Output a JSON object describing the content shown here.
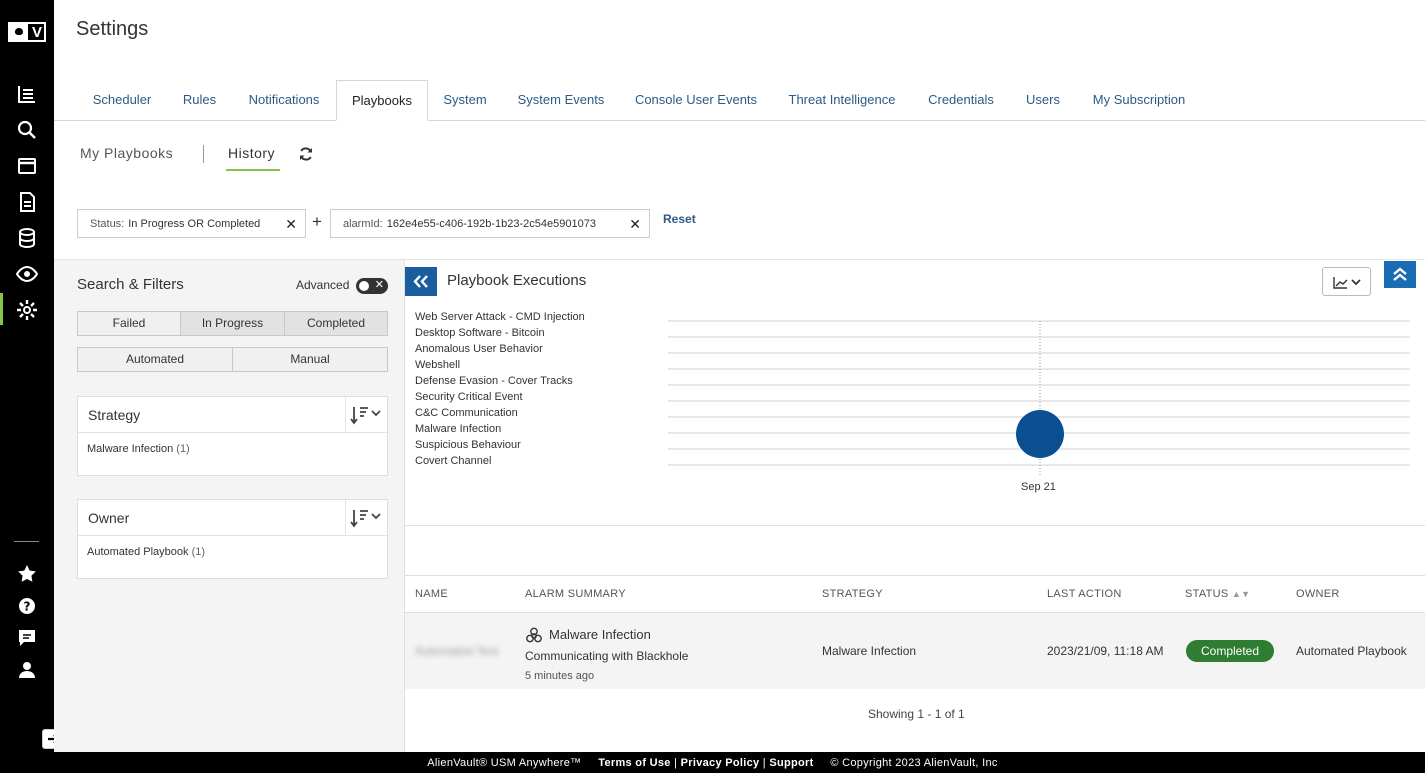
{
  "app": {
    "logo_text": "V"
  },
  "page": {
    "title": "Settings"
  },
  "tabs": [
    {
      "label": "Scheduler"
    },
    {
      "label": "Rules"
    },
    {
      "label": "Notifications"
    },
    {
      "label": "Playbooks"
    },
    {
      "label": "System"
    },
    {
      "label": "System Events"
    },
    {
      "label": "Console User Events"
    },
    {
      "label": "Threat Intelligence"
    },
    {
      "label": "Credentials"
    },
    {
      "label": "Users"
    },
    {
      "label": "My Subscription"
    }
  ],
  "subtabs": {
    "my_playbooks": "My Playbooks",
    "history": "History"
  },
  "filters": {
    "chip1_key": "Status:",
    "chip1_value": "In Progress OR Completed",
    "chip2_key": "alarmId:",
    "chip2_value": "162e4e55-c406-192b-1b23-2c54e5901073",
    "plus": "+",
    "reset": "Reset"
  },
  "sidebar": {
    "title": "Search & Filters",
    "advanced_label": "Advanced",
    "status_buttons": [
      "Failed",
      "In Progress",
      "Completed"
    ],
    "type_buttons": [
      "Automated",
      "Manual"
    ],
    "strategy": {
      "title": "Strategy",
      "item": "Malware Infection",
      "count": "(1)"
    },
    "owner": {
      "title": "Owner",
      "item": "Automated Playbook",
      "count": "(1)"
    }
  },
  "chart": {
    "title": "Playbook Executions"
  },
  "chart_data": {
    "type": "scatter",
    "categories": [
      "Web Server Attack - CMD Injection",
      "Desktop Software - Bitcoin",
      "Anomalous User Behavior",
      "Webshell",
      "Defense Evasion - Cover Tracks",
      "Security Critical Event",
      "C&C Communication",
      "Malware Infection",
      "Suspicious Behaviour",
      "Covert Channel"
    ],
    "x_ticks": [
      "Sep 21"
    ],
    "points": [
      {
        "x": "Sep 21",
        "y": "Malware Infection",
        "count": 1
      }
    ],
    "color": "#0a4f91",
    "grid": true
  },
  "table": {
    "headers": [
      "NAME",
      "ALARM SUMMARY",
      "STRATEGY",
      "LAST ACTION",
      "STATUS",
      "OWNER"
    ],
    "rows": [
      {
        "name": "Automated Test",
        "alarm_title": "Malware Infection",
        "alarm_sub": "Communicating with Blackhole",
        "alarm_time": "5 minutes ago",
        "strategy": "Malware Infection",
        "last_action": "2023/21/09, 11:18 AM",
        "status": "Completed",
        "owner": "Automated Playbook"
      }
    ],
    "showing": "Showing 1 - 1 of 1"
  },
  "footer": {
    "product": "AlienVault® USM Anywhere™",
    "terms": "Terms of Use",
    "privacy": "Privacy Policy",
    "support": "Support",
    "copyright": "© Copyright 2023 AlienVault, Inc",
    "sep": "|"
  },
  "colors": {
    "accent": "#85c447",
    "primary": "#1a5ea0",
    "status_completed": "#2e7d32",
    "link": "#2b5a87"
  }
}
